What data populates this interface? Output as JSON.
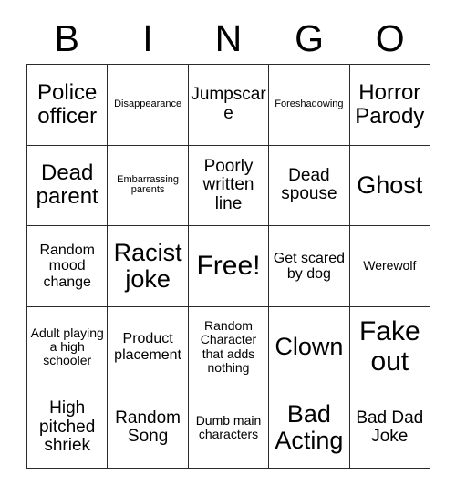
{
  "card": {
    "title": "BINGO",
    "header_letters": [
      "B",
      "I",
      "N",
      "G",
      "O"
    ],
    "columns": 5,
    "rows": 5,
    "free_space_label": "Free!",
    "free_space_position": "center",
    "colors": {
      "background": "#ffffff",
      "cell_background": "#ffffff",
      "border": "#2b2b2b",
      "text": "#000000"
    },
    "grid": [
      [
        {
          "text": "Police officer",
          "size": "lg"
        },
        {
          "text": "Disappearance",
          "size": "xxs"
        },
        {
          "text": "Jumpscare",
          "size": "md"
        },
        {
          "text": "Foreshadowing",
          "size": "xxs"
        },
        {
          "text": "Horror Parody",
          "size": "lg"
        }
      ],
      [
        {
          "text": "Dead parent",
          "size": "lg"
        },
        {
          "text": "Embarrassing parents",
          "size": "xxs"
        },
        {
          "text": "Poorly written line",
          "size": "md"
        },
        {
          "text": "Dead spouse",
          "size": "md"
        },
        {
          "text": "Ghost",
          "size": "xl"
        }
      ],
      [
        {
          "text": "Random mood change",
          "size": "sm"
        },
        {
          "text": "Racist joke",
          "size": "xl"
        },
        {
          "text": "Free!",
          "size": "xxl"
        },
        {
          "text": "Get scared by dog",
          "size": "sm"
        },
        {
          "text": "Werewolf",
          "size": "xs"
        }
      ],
      [
        {
          "text": "Adult playing a high schooler",
          "size": "xs"
        },
        {
          "text": "Product placement",
          "size": "sm"
        },
        {
          "text": "Random Character that adds nothing",
          "size": "xs"
        },
        {
          "text": "Clown",
          "size": "xl"
        },
        {
          "text": "Fake out",
          "size": "xxl"
        }
      ],
      [
        {
          "text": "High pitched shriek",
          "size": "md"
        },
        {
          "text": "Random Song",
          "size": "md"
        },
        {
          "text": "Dumb main characters",
          "size": "xs"
        },
        {
          "text": "Bad Acting",
          "size": "xl"
        },
        {
          "text": "Bad Dad Joke",
          "size": "md"
        }
      ]
    ]
  }
}
